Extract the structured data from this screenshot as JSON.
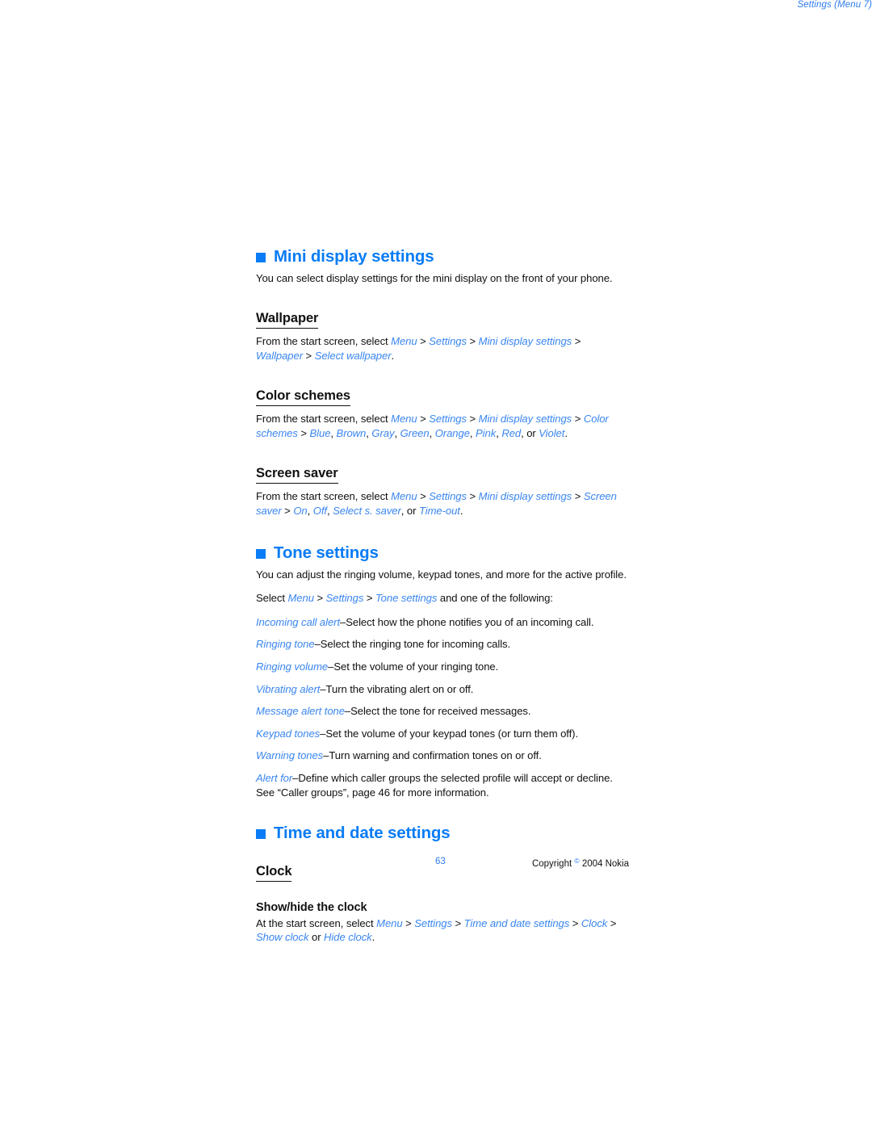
{
  "page": {
    "running_header": "Settings (Menu 7)",
    "page_number": "63",
    "copyright_prefix": "Copyright",
    "copyright_symbol": "©",
    "copyright_suffix": "2004 Nokia"
  },
  "sections": {
    "mini_display": {
      "heading": "Mini display settings",
      "intro": "You can select display settings for the mini display on the front of your phone.",
      "wallpaper": {
        "heading": "Wallpaper",
        "lead": "From the start screen, select ",
        "path": [
          "Menu",
          "Settings",
          "Mini display settings",
          "Wallpaper",
          "Select wallpaper"
        ],
        "terminator": "."
      },
      "color_schemes": {
        "heading": "Color schemes",
        "lead": "From the start screen, select ",
        "path": [
          "Menu",
          "Settings",
          "Mini display settings",
          "Color schemes"
        ],
        "options_prefix": "",
        "options": [
          "Blue",
          "Brown",
          "Gray",
          "Green",
          "Orange",
          "Pink",
          "Red"
        ],
        "options_conjunction": "or",
        "options_last": "Violet",
        "terminator": "."
      },
      "screen_saver": {
        "heading": "Screen saver",
        "lead": "From the start screen, select ",
        "path": [
          "Menu",
          "Settings",
          "Mini display settings",
          "Screen saver"
        ],
        "options": [
          "On",
          "Off",
          "Select s. saver"
        ],
        "options_conjunction": "or",
        "options_last": "Time-out",
        "terminator": "."
      }
    },
    "tone_settings": {
      "heading": "Tone settings",
      "intro": "You can adjust the ringing volume, keypad tones, and more for the active profile.",
      "select_lead": "Select ",
      "select_path": [
        "Menu",
        "Settings",
        "Tone settings"
      ],
      "select_tail": " and one of the following:",
      "items": [
        {
          "term": "Incoming call alert",
          "desc": "–Select how the phone notifies you of an incoming call."
        },
        {
          "term": "Ringing tone",
          "desc": "–Select the ringing tone for incoming calls."
        },
        {
          "term": "Ringing volume",
          "desc": "–Set the volume of your ringing tone."
        },
        {
          "term": "Vibrating alert",
          "desc": "–Turn the vibrating alert on or off."
        },
        {
          "term": "Message alert tone",
          "desc": "–Select the tone for received messages."
        },
        {
          "term": "Keypad tones",
          "desc": "–Set the volume of your keypad tones (or turn them off)."
        },
        {
          "term": "Warning tones",
          "desc": "–Turn warning and confirmation tones on or off."
        },
        {
          "term": "Alert for",
          "desc": "–Define which caller groups the selected profile will accept or decline. See “Caller groups”, page 46 for more information."
        }
      ]
    },
    "time_and_date": {
      "heading": "Time and date settings",
      "clock": {
        "heading": "Clock",
        "show_hide": {
          "heading": "Show/hide the clock",
          "lead": "At the start screen, select ",
          "path": [
            "Menu",
            "Settings",
            "Time and date settings",
            "Clock"
          ],
          "options": [
            "Show clock"
          ],
          "options_conjunction": "or",
          "options_last": "Hide clock",
          "terminator": "."
        }
      }
    }
  },
  "colors": {
    "heading_blue": "#0A7CF5",
    "ui_term_blue": "#3A86F0",
    "header_blue": "#2E7BEF",
    "body_black": "#111111"
  }
}
